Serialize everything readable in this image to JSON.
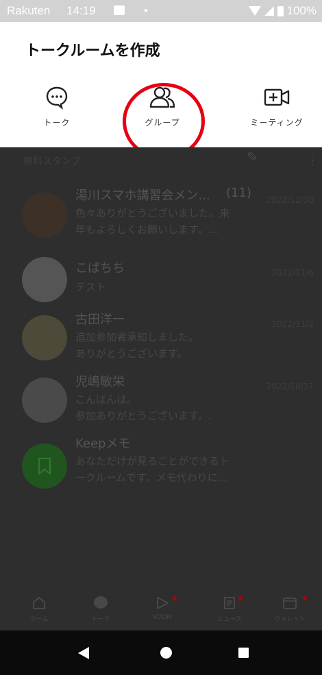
{
  "status_bar": {
    "carrier": "Rakuten",
    "time": "14:19",
    "dot": "•",
    "battery": "100%"
  },
  "sheet": {
    "title": "トークルームを作成",
    "options": [
      {
        "label": "トーク",
        "icon": "chat-bubble-icon"
      },
      {
        "label": "グループ",
        "icon": "group-icon"
      },
      {
        "label": "ミーティング",
        "icon": "video-add-icon"
      }
    ],
    "highlight_color": "#e60012"
  },
  "background": {
    "section_label": "無料スタンプ",
    "chats": [
      {
        "name": "湯川スマホ講習会メン...",
        "count": "(11)",
        "date": "2022/12/30",
        "line1": "色々ありがとうございました。来",
        "line2": "年もよろしくお願いします。..."
      },
      {
        "name": "こばちち",
        "count": "",
        "date": "2022/11/6",
        "line1": "テスト",
        "line2": ""
      },
      {
        "name": "古田洋一",
        "count": "",
        "date": "2022/11/2",
        "line1": "追加参加者承知しました。",
        "line2": "ありがとうございます。"
      },
      {
        "name": "児嶋敏栄",
        "count": "",
        "date": "2022/10/17",
        "line1": "こんばんは。",
        "line2": "参加ありがとうございます。."
      },
      {
        "name": "Keepメモ",
        "count": "",
        "date": "",
        "line1": "あなただけが見ることができるト",
        "line2": "ークルームです。メモ代わりに..."
      }
    ]
  },
  "tabbar": {
    "tabs": [
      {
        "label": "ホーム",
        "icon": "home-icon"
      },
      {
        "label": "トーク",
        "icon": "talk-icon"
      },
      {
        "label": "VOOM",
        "icon": "voom-icon"
      },
      {
        "label": "ニュース",
        "icon": "news-icon"
      },
      {
        "label": "ウォレット",
        "icon": "wallet-icon"
      }
    ]
  }
}
